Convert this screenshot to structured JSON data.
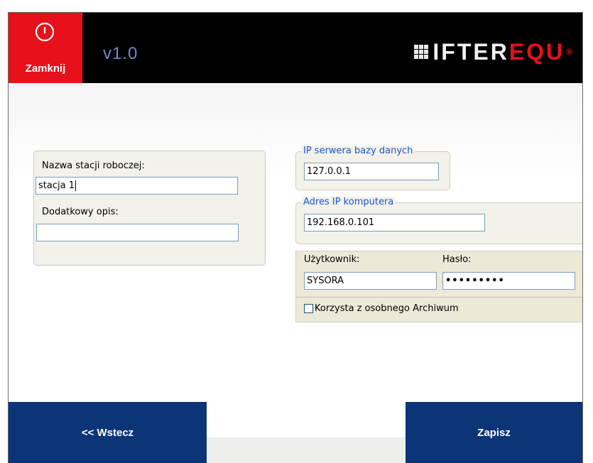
{
  "header": {
    "close_label": "Zamknij",
    "version": "v1.0",
    "logo": {
      "white_text": "IFTER",
      "red_text": "EQU",
      "mark": "®"
    }
  },
  "station": {
    "name_label": "Nazwa stacji roboczej:",
    "name_value": "stacja 1",
    "desc_label": "Dodatkowy opis:",
    "desc_value": ""
  },
  "db_server": {
    "legend": "IP serwera bazy danych",
    "value": "127.0.0.1"
  },
  "computer_ip": {
    "legend": "Adres IP komputera",
    "value": "192.168.0.101"
  },
  "login": {
    "user_label": "Użytkownik:",
    "user_value": "SYSORA",
    "pass_label": "Hasło:",
    "pass_value": "•••••••••"
  },
  "archive": {
    "checkbox_label": "Korzysta z osobnego Archiwum",
    "checked": false
  },
  "nav": {
    "back_label": "<< Wstecz",
    "save_label": "Zapisz"
  },
  "colors": {
    "accent_red": "#e8101a",
    "nav_blue": "#0c3578",
    "legend_blue": "#1a55d1"
  }
}
